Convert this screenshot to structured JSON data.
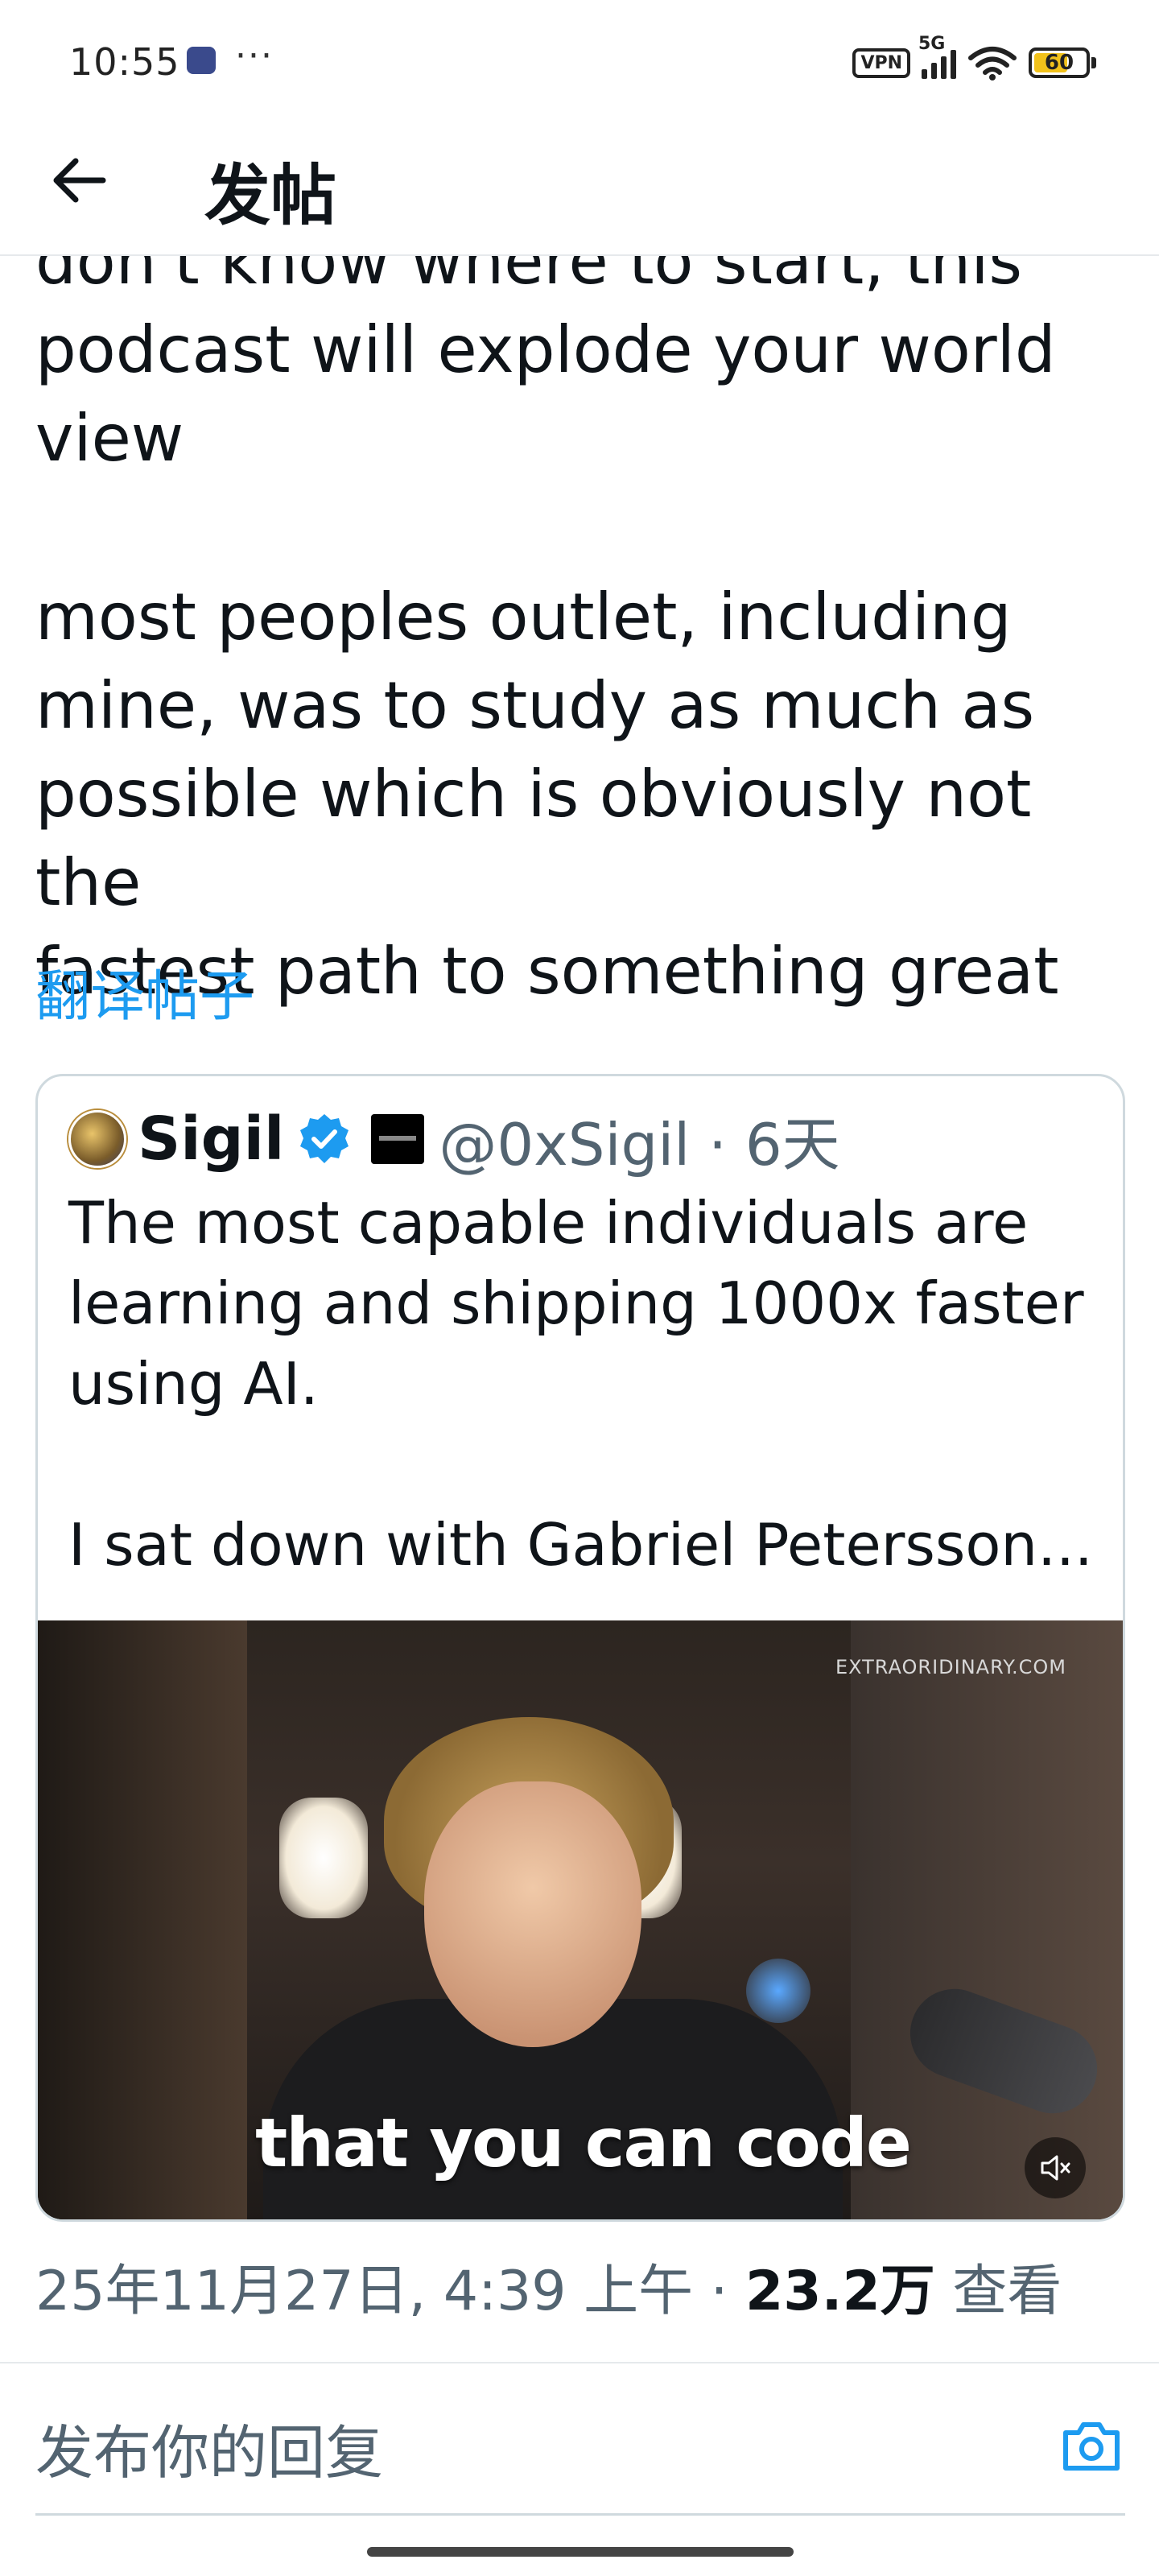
{
  "status_bar": {
    "time": "10:55",
    "dots": "···",
    "vpn": "VPN",
    "network": "5G",
    "battery": "60",
    "battery_level": 0.6
  },
  "header": {
    "title": "发帖"
  },
  "tweet": {
    "paragraph1": "don't know where to start, this\npodcast will explode your world\nview",
    "paragraph2": "most peoples outlet, including\nmine, was to study as much as\npossible which is obviously not the\nfastest path to something great",
    "translate_label": "翻译帖子"
  },
  "quote": {
    "name": "Sigil",
    "handle": "@0xSigil · 6天",
    "text": "The most capable individuals are\nlearning and shipping 1000x faster\nusing AI.\n\nI sat down with Gabriel Petersson...",
    "video": {
      "watermark": "EXTRAORIDINARY.COM",
      "caption": "that you can code"
    }
  },
  "meta": {
    "datetime": "25年11月27日, 4:39 上午 · ",
    "views_count": "23.2万",
    "views_label": " 查看"
  },
  "reply": {
    "placeholder": "发布你的回复"
  },
  "colors": {
    "accent": "#1d9bf0",
    "text": "#0f1419",
    "secondary": "#536471"
  }
}
